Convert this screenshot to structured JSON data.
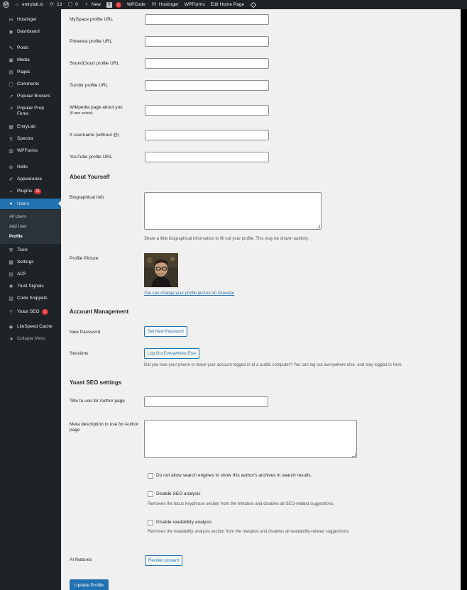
{
  "colors": {
    "admin_bg": "#1d2327",
    "accent": "#2271b1",
    "badge": "#d63638",
    "content_bg": "#f0f0f1"
  },
  "admin_bar": {
    "site_name": "entrylab.io",
    "updates_count": "13",
    "comments_count": "0",
    "new_label": "New",
    "yoast_badge": "1",
    "items": [
      "WPCode",
      "Hostinger",
      "WPForms",
      "Edit Home Page"
    ]
  },
  "sidebar": {
    "items": [
      {
        "label": "Hostinger",
        "icon": "hostinger-icon"
      },
      {
        "label": "Dashboard",
        "icon": "dashboard-icon"
      },
      {
        "label": "Posts",
        "icon": "pin-icon"
      },
      {
        "label": "Media",
        "icon": "media-icon"
      },
      {
        "label": "Pages",
        "icon": "pages-icon"
      },
      {
        "label": "Comments",
        "icon": "comments-icon"
      },
      {
        "label": "Popular Brokers",
        "icon": "chart-icon"
      },
      {
        "label": "Popular Prop Firms",
        "icon": "chart-icon"
      },
      {
        "label": "EntryLab",
        "icon": "entrylab-icon"
      },
      {
        "label": "Spectra",
        "icon": "spectra-icon"
      },
      {
        "label": "WPForms",
        "icon": "wpforms-icon"
      },
      {
        "label": "Hello",
        "icon": "hello-icon"
      },
      {
        "label": "Appearance",
        "icon": "brush-icon"
      },
      {
        "label": "Plugins",
        "icon": "plugin-icon",
        "badge": "11"
      },
      {
        "label": "Users",
        "icon": "user-icon"
      },
      {
        "label": "Tools",
        "icon": "wrench-icon"
      },
      {
        "label": "Settings",
        "icon": "settings-icon"
      },
      {
        "label": "ACF",
        "icon": "acf-icon"
      },
      {
        "label": "Trust Signals",
        "icon": "gear-icon"
      },
      {
        "label": "Code Snippets",
        "icon": "code-icon"
      },
      {
        "label": "Yoast SEO",
        "icon": "yoast-icon",
        "badge": "1"
      },
      {
        "label": "LiteSpeed Cache",
        "icon": "litespeed-icon"
      },
      {
        "label": "Collapse Menu",
        "icon": "collapse-icon"
      }
    ],
    "users_submenu": [
      "All Users",
      "Add User",
      "Profile"
    ]
  },
  "profile_fields": [
    {
      "label": "MySpace profile URL",
      "value": ""
    },
    {
      "label": "Pinterest profile URL",
      "value": ""
    },
    {
      "label": "SoundCloud profile URL",
      "value": ""
    },
    {
      "label": "Tumblr profile URL",
      "value": ""
    },
    {
      "label": "Wikipedia page about you",
      "sublabel": "(if one exists)",
      "value": ""
    },
    {
      "label": "X username (without @)",
      "value": ""
    },
    {
      "label": "YouTube profile URL",
      "value": ""
    }
  ],
  "about": {
    "title": "About Yourself",
    "bio_label": "Biographical Info",
    "bio_value": "",
    "bio_desc": "Share a little biographical information to fill out your profile. This may be shown publicly.",
    "picture_label": "Profile Picture",
    "gravatar_link": "You can change your profile picture on Gravatar"
  },
  "account": {
    "title": "Account Management",
    "password_label": "New Password",
    "password_button": "Set New Password",
    "sessions_label": "Sessions",
    "sessions_button": "Log Out Everywhere Else",
    "sessions_desc": "Did you lose your phone or leave your account logged in at a public computer? You can log out everywhere else, and stay logged in here."
  },
  "yoast": {
    "title": "Yoast SEO settings",
    "author_title_label": "Title to use for Author page",
    "author_title_value": "",
    "meta_desc_label": "Meta description to use for Author page",
    "meta_desc_value": "",
    "noindex_label": "Do not allow search engines to show this author's archives in search results.",
    "noindex_checked": false,
    "disable_seo_label": "Disable SEO analysis",
    "disable_seo_checked": false,
    "disable_seo_desc": "Removes the focus keyphrase section from the metabox and disables all SEO-related suggestions.",
    "disable_read_label": "Disable readability analysis",
    "disable_read_checked": false,
    "disable_read_desc": "Removes the readability analysis section from the metabox and disables all readability-related suggestions."
  },
  "ai": {
    "label": "AI features",
    "button": "Revoke consent"
  },
  "submit": {
    "label": "Update Profile"
  }
}
